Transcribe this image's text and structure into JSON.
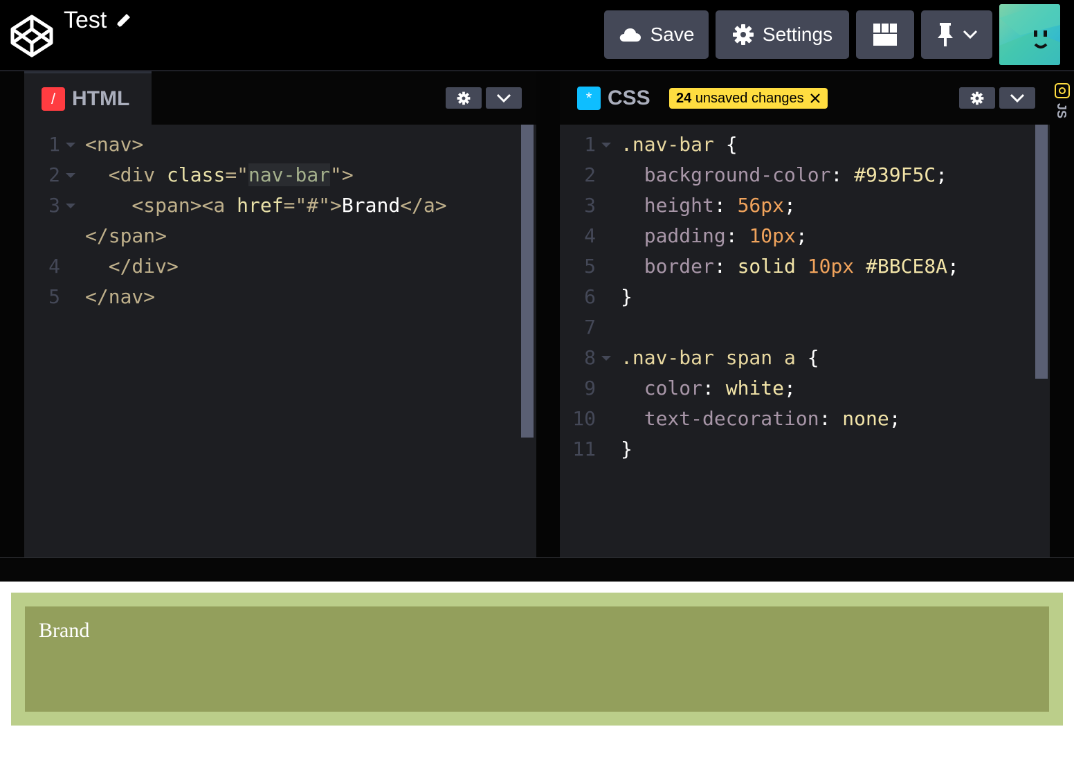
{
  "header": {
    "title": "Test",
    "save_label": "Save",
    "settings_label": "Settings"
  },
  "html_editor": {
    "tab_label": "HTML",
    "lines": [
      {
        "no": "1",
        "fold": true,
        "tokens": [
          {
            "t": "<nav>",
            "c": "tag"
          }
        ]
      },
      {
        "no": "2",
        "fold": true,
        "tokens": [
          {
            "t": "  <div ",
            "c": "tag"
          },
          {
            "t": "class",
            "c": "attr"
          },
          {
            "t": "=\"",
            "c": "tag"
          },
          {
            "t": "nav-bar",
            "c": "str hl"
          },
          {
            "t": "\">",
            "c": "tag"
          }
        ]
      },
      {
        "no": "3",
        "fold": true,
        "tokens": [
          {
            "t": "    <span><a ",
            "c": "tag"
          },
          {
            "t": "href",
            "c": "attr"
          },
          {
            "t": "=\"#\">",
            "c": "tag"
          },
          {
            "t": "Brand",
            "c": "plain"
          },
          {
            "t": "</a>",
            "c": "tag"
          }
        ]
      },
      {
        "no": "",
        "fold": false,
        "tokens": [
          {
            "t": "</span>",
            "c": "tag"
          }
        ]
      },
      {
        "no": "4",
        "fold": false,
        "tokens": [
          {
            "t": "  </div>",
            "c": "tag"
          }
        ]
      },
      {
        "no": "5",
        "fold": false,
        "tokens": [
          {
            "t": "</nav>",
            "c": "tag"
          }
        ]
      }
    ]
  },
  "css_editor": {
    "tab_label": "CSS",
    "unsaved_count": "24",
    "unsaved_text": "unsaved changes",
    "lines": [
      {
        "no": "1",
        "fold": true,
        "tokens": [
          {
            "t": ".nav-bar ",
            "c": "sel"
          },
          {
            "t": "{",
            "c": "plain"
          }
        ]
      },
      {
        "no": "2",
        "fold": false,
        "tokens": [
          {
            "t": "  background-color",
            "c": "prop"
          },
          {
            "t": ": ",
            "c": "plain"
          },
          {
            "t": "#939F5C",
            "c": "val"
          },
          {
            "t": ";",
            "c": "plain"
          }
        ]
      },
      {
        "no": "3",
        "fold": false,
        "tokens": [
          {
            "t": "  height",
            "c": "prop"
          },
          {
            "t": ": ",
            "c": "plain"
          },
          {
            "t": "56px",
            "c": "num"
          },
          {
            "t": ";",
            "c": "plain"
          }
        ]
      },
      {
        "no": "4",
        "fold": false,
        "tokens": [
          {
            "t": "  padding",
            "c": "prop"
          },
          {
            "t": ": ",
            "c": "plain"
          },
          {
            "t": "10px",
            "c": "num"
          },
          {
            "t": ";",
            "c": "plain"
          }
        ]
      },
      {
        "no": "5",
        "fold": false,
        "tokens": [
          {
            "t": "  border",
            "c": "prop"
          },
          {
            "t": ": ",
            "c": "plain"
          },
          {
            "t": "solid ",
            "c": "val"
          },
          {
            "t": "10px ",
            "c": "num"
          },
          {
            "t": "#BBCE8A",
            "c": "val"
          },
          {
            "t": ";",
            "c": "plain"
          }
        ]
      },
      {
        "no": "6",
        "fold": false,
        "tokens": [
          {
            "t": "}",
            "c": "plain"
          }
        ]
      },
      {
        "no": "7",
        "fold": false,
        "tokens": []
      },
      {
        "no": "8",
        "fold": true,
        "tokens": [
          {
            "t": ".nav-bar span a ",
            "c": "sel"
          },
          {
            "t": "{",
            "c": "plain"
          }
        ]
      },
      {
        "no": "9",
        "fold": false,
        "tokens": [
          {
            "t": "  color",
            "c": "prop"
          },
          {
            "t": ": ",
            "c": "plain"
          },
          {
            "t": "white",
            "c": "val"
          },
          {
            "t": ";",
            "c": "plain"
          }
        ]
      },
      {
        "no": "10",
        "fold": false,
        "tokens": [
          {
            "t": "  text-decoration",
            "c": "prop"
          },
          {
            "t": ": ",
            "c": "plain"
          },
          {
            "t": "none",
            "c": "val"
          },
          {
            "t": ";",
            "c": "plain"
          }
        ]
      },
      {
        "no": "11",
        "fold": false,
        "tokens": [
          {
            "t": "}",
            "c": "plain"
          }
        ]
      }
    ]
  },
  "js_editor": {
    "tab_label": "JS"
  },
  "preview": {
    "brand_link": "Brand",
    "nav_bg": "#939F5C",
    "nav_border": "#BBCE8A"
  },
  "icons": {
    "logo": "codepen-logo-icon",
    "edit": "pencil-icon",
    "save": "cloud-icon",
    "settings": "gear-icon",
    "layout": "layout-grid-icon",
    "pin": "pin-icon"
  }
}
